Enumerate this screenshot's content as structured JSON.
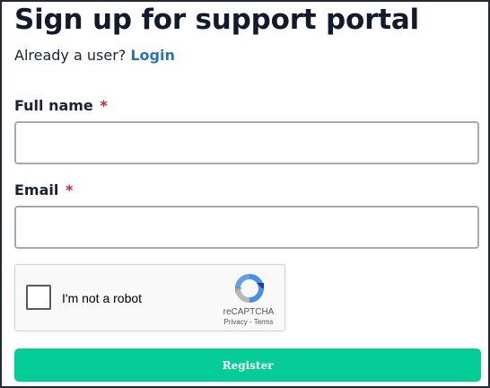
{
  "header": {
    "title": "Sign up for support portal",
    "prompt_text": "Already a user?",
    "login_link": "Login"
  },
  "form": {
    "full_name": {
      "label": "Full name",
      "required_marker": "*",
      "value": ""
    },
    "email": {
      "label": "Email",
      "required_marker": "*",
      "value": ""
    },
    "recaptcha": {
      "label": "I'm not a robot",
      "brand": "reCAPTCHA",
      "privacy": "Privacy",
      "separator": " - ",
      "terms": "Terms",
      "checked": false
    },
    "submit_label": "Register"
  },
  "colors": {
    "accent": "#04cc96",
    "link": "#2a72b8",
    "required": "#c0282d",
    "title": "#131a2b"
  }
}
